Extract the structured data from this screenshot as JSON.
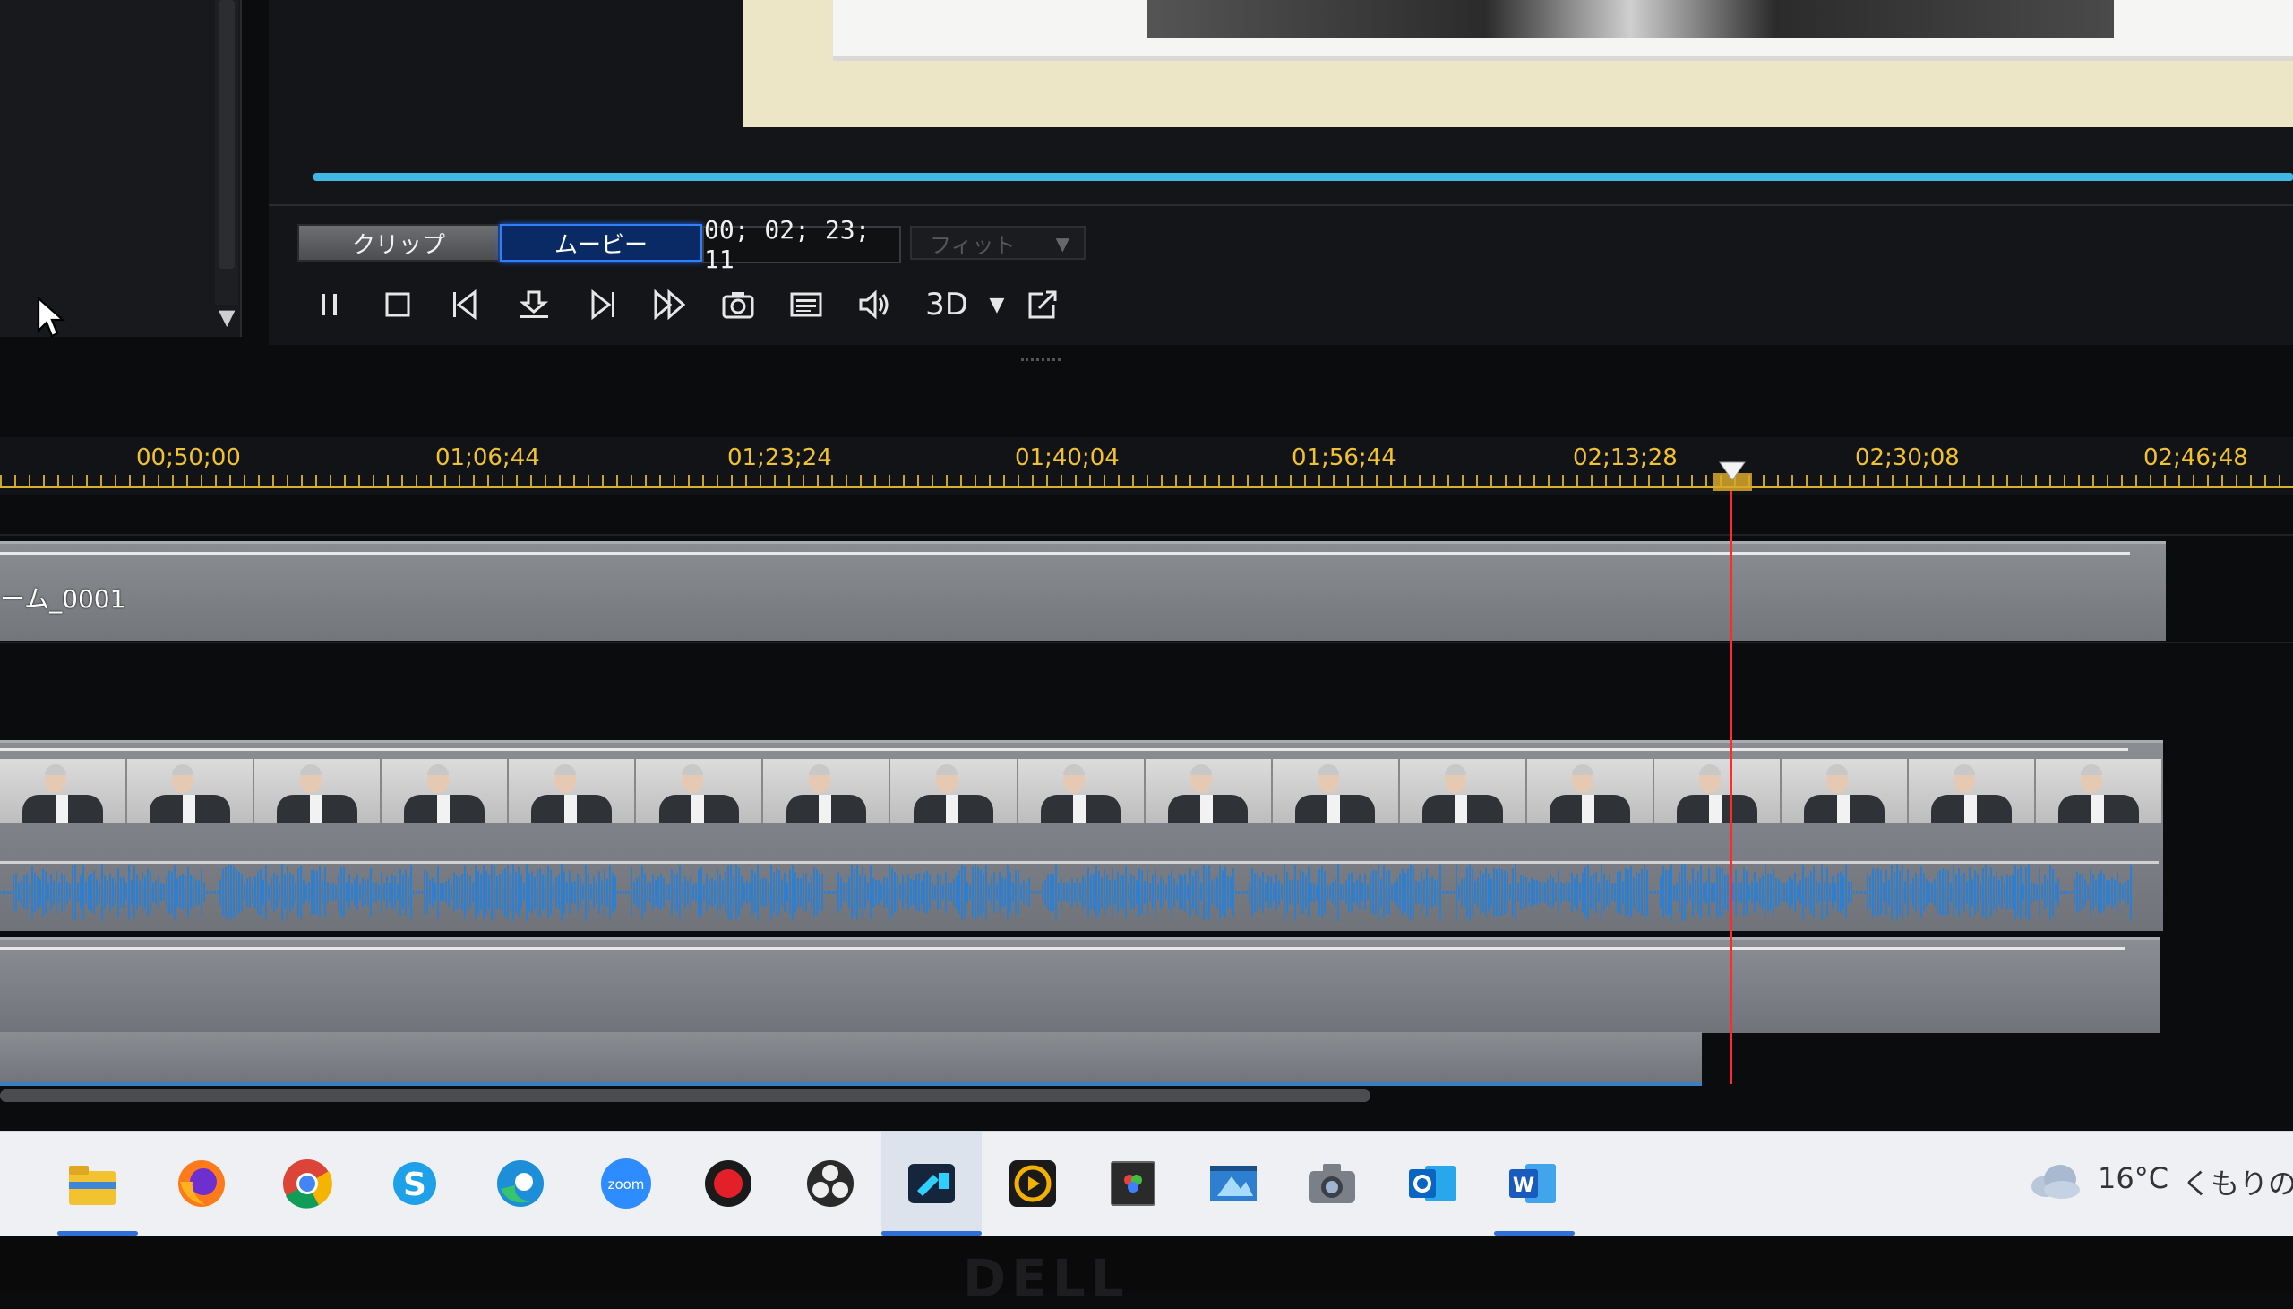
{
  "preview": {
    "clip_label": "クリップ",
    "movie_label": "ムービー",
    "timecode": "00; 02; 23; 11",
    "fit_label": "フィット",
    "threed_label": "3D"
  },
  "ruler": {
    "labels": [
      "00;50;00",
      "01;06;44",
      "01;23;24",
      "01;40;04",
      "01;56;44",
      "02;13;28",
      "02;30;08",
      "02;46;48"
    ]
  },
  "tracks": {
    "title_clip_label": "ーム_0001"
  },
  "colors": {
    "accent_blue": "#2f7fff",
    "playhead_red": "#ff2a2a",
    "ruler_yellow": "#f0c232",
    "waveform_blue": "#2f7fd0"
  },
  "taskbar": {
    "apps": [
      "file-explorer-icon",
      "firefox-icon",
      "chrome-icon",
      "skype-icon",
      "edge-icon",
      "zoom-icon",
      "record-icon",
      "obs-icon",
      "video-editor-icon",
      "media-player-icon",
      "photo-app-icon",
      "movie-app-icon",
      "camera-icon",
      "outlook-icon",
      "word-icon"
    ],
    "zoom_label": "zoom",
    "temperature": "16°C",
    "weather": "くもりのち"
  },
  "bezel": {
    "brand": "DELL"
  }
}
